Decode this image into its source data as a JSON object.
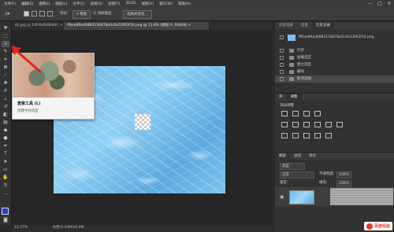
{
  "menubar": {
    "items": [
      "文件(F)",
      "编辑(E)",
      "图像(I)",
      "图层(L)",
      "文字(Y)",
      "选择(S)",
      "滤镜(T)",
      "3D(D)",
      "视图(V)",
      "窗口(W)",
      "帮助(H)"
    ],
    "controls": [
      "—",
      "□",
      "✕"
    ]
  },
  "options_bar": {
    "feather_label": "羽化:",
    "feather_value": "0 像素",
    "antialias_label": "消除锯齿",
    "select_mask_label": "选择并遮住..."
  },
  "tabs": [
    {
      "label": "t0_jpg @ 100%(RGB/8#) ×",
      "active": false
    },
    {
      "label": "ff6ea89ad0883156878a5c0a53f63f10.png @ 11.8% (图层 0, RGB/8) ×",
      "active": true
    }
  ],
  "status": {
    "zoom": "11.77%",
    "doc": "文档:9.34M/16.6M"
  },
  "tooltip": {
    "title": "套索工具 (L)",
    "desc": "创建手绘选区"
  },
  "history_panel": {
    "tabs": [
      "历史记录",
      "信息",
      "历史记录"
    ],
    "snapshot": "ff6ea89ad0883156878a5c0a53f63f10.png",
    "items": [
      "打开",
      "加载选区",
      "建立选区",
      "删除",
      "取消选择"
    ],
    "active_index": 4
  },
  "adjust_panel": {
    "tabs": [
      "库",
      "调整"
    ],
    "label": "添加调整"
  },
  "layers_panel": {
    "tabs": [
      "图层",
      "通道",
      "路径"
    ],
    "kind_label": "类型",
    "blend_mode": "正常",
    "opacity_label": "不透明度:",
    "opacity_value": "100%",
    "lock_label": "锁定:",
    "fill_label": "填充:",
    "fill_value": "100%"
  },
  "watermark": {
    "text": "百度经验"
  }
}
